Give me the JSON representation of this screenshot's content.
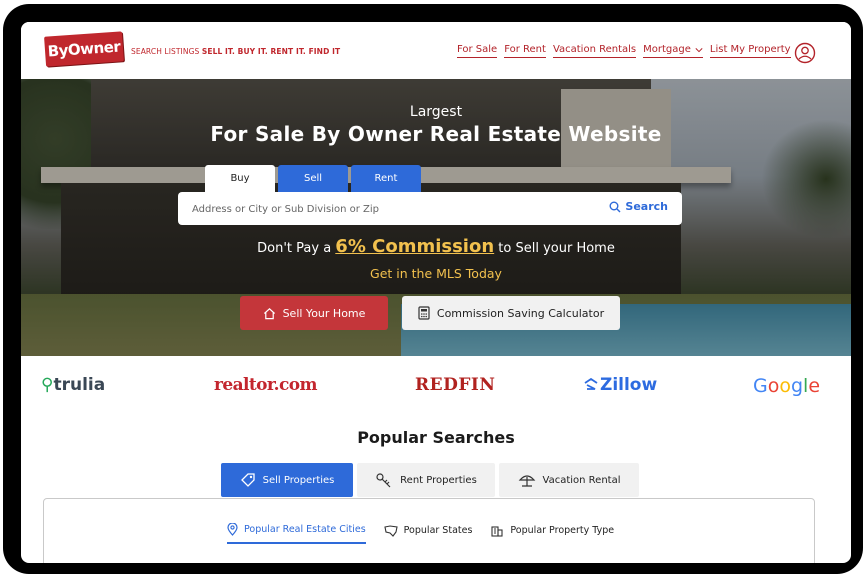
{
  "header": {
    "logo_text": "ByOwner",
    "tagline_prefix": "SEARCH LISTINGS ",
    "tagline_bold": "SELL IT. BUY IT. RENT IT. FIND IT",
    "nav": [
      "For Sale",
      "For Rent",
      "Vacation Rentals",
      "Mortgage",
      "List My Property"
    ]
  },
  "hero": {
    "pre_title": "Largest",
    "title": "For Sale By Owner Real Estate Website",
    "tabs": [
      "Buy",
      "Sell",
      "Rent"
    ],
    "active_tab": "Buy",
    "search_placeholder": "Address or City or Sub Division or Zip",
    "search_button": "Search",
    "promo_prefix": "Don't Pay a ",
    "promo_highlight": "6% Commission",
    "promo_suffix": " to Sell your Home",
    "promo_sub": "Get in the MLS Today",
    "sell_button": "Sell Your Home",
    "calc_button": "Commission Saving Calculator"
  },
  "partners": {
    "trulia": "trulia",
    "realtor": "realtor.com",
    "redfin": "REDFIN",
    "zillow": "Zillow",
    "google": "Google"
  },
  "popular": {
    "title": "Popular Searches",
    "tabs": [
      "Sell Properties",
      "Rent Properties",
      "Vacation Rental"
    ],
    "subtabs": [
      "Popular Real Estate Cities",
      "Popular States",
      "Popular Property Type"
    ]
  },
  "colors": {
    "brand_red": "#c0272d",
    "accent_blue": "#2e6ad9",
    "highlight_gold": "#f2c14e"
  }
}
